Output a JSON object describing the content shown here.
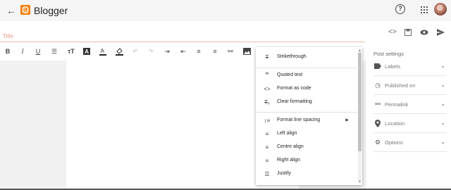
{
  "app": {
    "title": "Blogger"
  },
  "title_field": {
    "placeholder": "Title"
  },
  "toolbar": {
    "buttons": [
      "bold-icon",
      "italic-icon",
      "underline-icon",
      "strikethrough-bar-icon",
      "font-size-icon",
      "text-background-icon",
      "text-color-icon",
      "highlight-icon",
      "undo-icon",
      "redo-icon",
      "indent-icon",
      "outdent-icon",
      "bulleted-list-icon",
      "numbered-list-icon",
      "link-icon",
      "image-icon"
    ]
  },
  "format_menu": {
    "items": [
      {
        "label": "Strikethrough",
        "icon": "strikethrough-icon"
      },
      {
        "label": "Quoted text",
        "icon": "quote-icon"
      },
      {
        "label": "Format as code",
        "icon": "code-icon"
      },
      {
        "label": "Clear formatting",
        "icon": "clear-format-icon"
      },
      {
        "label": "Format line spacing",
        "icon": "line-spacing-icon"
      },
      {
        "label": "Left align",
        "icon": "align-left-icon"
      },
      {
        "label": "Centre align",
        "icon": "align-center-icon"
      },
      {
        "label": "Right align",
        "icon": "align-right-icon"
      },
      {
        "label": "Justify",
        "icon": "justify-icon"
      }
    ]
  },
  "post_settings": {
    "title": "Post settings",
    "items": [
      {
        "label": "Labels",
        "icon": "label-icon"
      },
      {
        "label": "Published on",
        "icon": "clock-icon"
      },
      {
        "label": "Permalink",
        "icon": "link-icon"
      },
      {
        "label": "Location",
        "icon": "location-pin-icon"
      },
      {
        "label": "Options",
        "icon": "gear-icon"
      }
    ]
  },
  "colors": {
    "brand": "#f57d00",
    "title_underline": "#f2b8a6"
  }
}
